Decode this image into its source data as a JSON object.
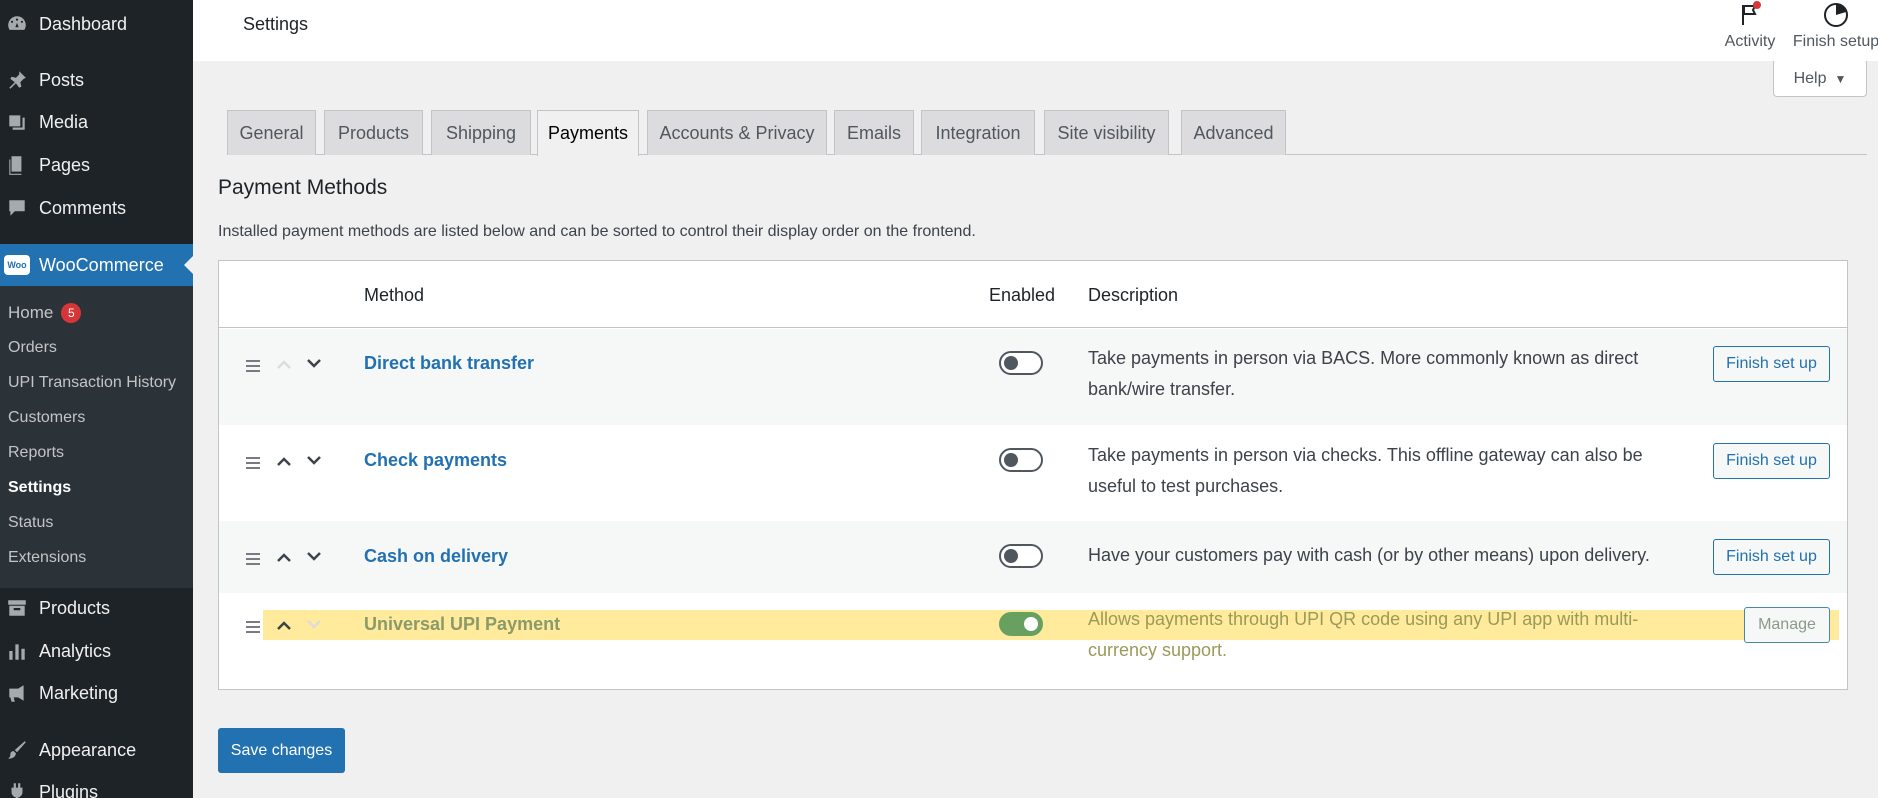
{
  "sidebar": {
    "top_items": [
      {
        "label": "Dashboard",
        "icon": "dashboard-icon"
      },
      {
        "label": "Posts",
        "icon": "pin-icon"
      },
      {
        "label": "Media",
        "icon": "media-icon"
      },
      {
        "label": "Pages",
        "icon": "pages-icon"
      },
      {
        "label": "Comments",
        "icon": "comment-icon"
      },
      {
        "label": "WooCommerce",
        "icon": "woo-icon"
      }
    ],
    "woo_logo": "Woo",
    "submenu": [
      {
        "label": "Home",
        "badge": "5"
      },
      {
        "label": "Orders"
      },
      {
        "label": "UPI Transaction History"
      },
      {
        "label": "Customers"
      },
      {
        "label": "Reports"
      },
      {
        "label": "Settings"
      },
      {
        "label": "Status"
      },
      {
        "label": "Extensions"
      }
    ],
    "bottom_items": [
      {
        "label": "Products",
        "icon": "archive-icon"
      },
      {
        "label": "Analytics",
        "icon": "bar-chart-icon"
      },
      {
        "label": "Marketing",
        "icon": "megaphone-icon"
      },
      {
        "label": "Appearance",
        "icon": "brush-icon"
      },
      {
        "label": "Plugins",
        "icon": "plugin-icon"
      }
    ]
  },
  "header": {
    "title": "Settings",
    "activity_label": "Activity",
    "finish_setup_label": "Finish setup",
    "help_label": "Help"
  },
  "tabs": [
    "General",
    "Products",
    "Shipping",
    "Payments",
    "Accounts & Privacy",
    "Emails",
    "Integration",
    "Site visibility",
    "Advanced"
  ],
  "active_tab": "Payments",
  "section": {
    "title": "Payment Methods",
    "description": "Installed payment methods are listed below and can be sorted to control their display order on the frontend."
  },
  "table": {
    "headers": {
      "method": "Method",
      "enabled": "Enabled",
      "description": "Description"
    },
    "rows": [
      {
        "name": "Direct bank transfer",
        "enabled": false,
        "description": "Take payments in person via BACS. More commonly known as direct bank/wire transfer.",
        "action": "Finish set up"
      },
      {
        "name": "Check payments",
        "enabled": false,
        "description": "Take payments in person via checks. This offline gateway can also be useful to test purchases.",
        "action": "Finish set up"
      },
      {
        "name": "Cash on delivery",
        "enabled": false,
        "description": "Have your customers pay with cash (or by other means) upon delivery.",
        "action": "Finish set up"
      },
      {
        "name": "Universal UPI Payment",
        "enabled": true,
        "description": "Allows payments through UPI QR code using any UPI app with multi-currency support.",
        "action": "Manage"
      }
    ]
  },
  "save_label": "Save changes",
  "colors": {
    "sidebar_bg": "#1d2327",
    "accent": "#2271b1",
    "highlight": "#ffe990",
    "badge": "#d63638",
    "toggle_on": "#2271b1"
  }
}
